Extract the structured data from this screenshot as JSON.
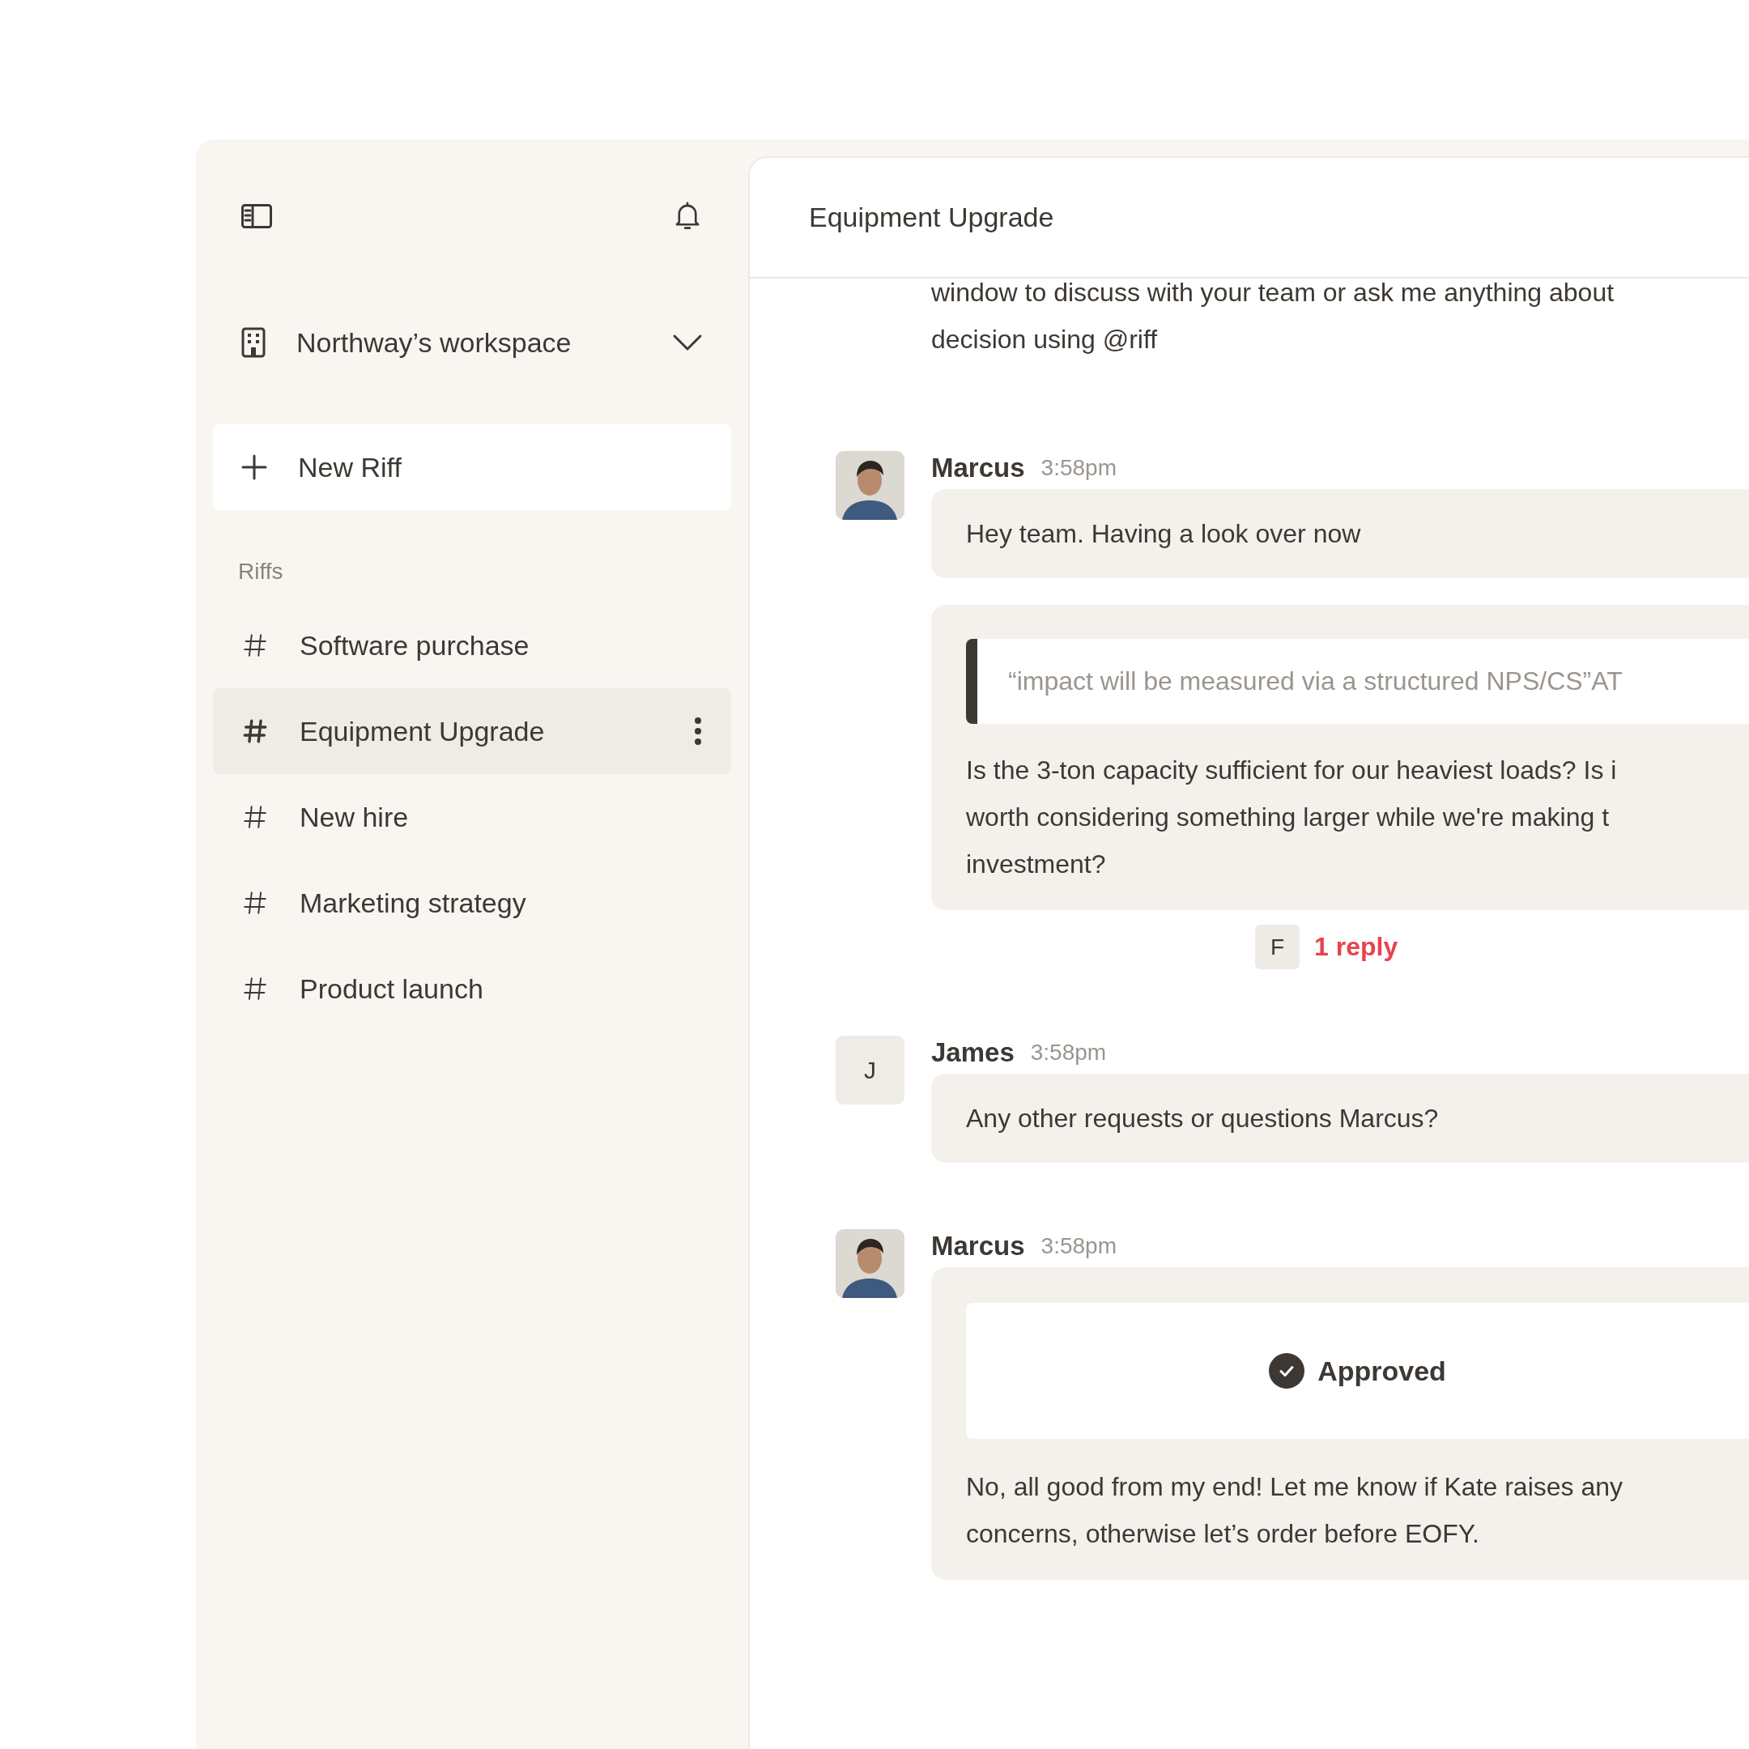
{
  "sidebar": {
    "workspace": "Northway’s workspace",
    "new_button": "New Riff",
    "section_label": "Riffs",
    "items": [
      {
        "label": "Software purchase",
        "selected": false
      },
      {
        "label": "Equipment Upgrade",
        "selected": true
      },
      {
        "label": "New hire",
        "selected": false
      },
      {
        "label": "Marketing strategy",
        "selected": false
      },
      {
        "label": "Product launch",
        "selected": false
      }
    ]
  },
  "channel": {
    "title": "Equipment Upgrade"
  },
  "intro_lines": [
    "window to discuss with your team or ask me anything about",
    "decision using @riff"
  ],
  "messages": [
    {
      "author": "Marcus",
      "time": "3:58pm",
      "avatar": {
        "kind": "picture"
      },
      "blocks": [
        {
          "kind": "text",
          "lines": [
            "Hey team. Having a look over now"
          ]
        },
        {
          "kind": "quote",
          "quote": "“impact will be measured via a structured NPS/CS”AT",
          "lines": [
            "Is the 3-ton capacity sufficient for our heaviest loads? Is i",
            "worth considering something larger while we're making t",
            "investment?"
          ],
          "thread": {
            "initial": "F",
            "replies": "1 reply"
          }
        }
      ]
    },
    {
      "author": "James",
      "time": "3:58pm",
      "avatar": {
        "kind": "initial",
        "initial": "J"
      },
      "blocks": [
        {
          "kind": "text",
          "lines": [
            "Any other requests or questions Marcus?"
          ]
        }
      ]
    },
    {
      "author": "Marcus",
      "time": "3:58pm",
      "avatar": {
        "kind": "picture"
      },
      "blocks": [
        {
          "kind": "status",
          "status": "Approved",
          "lines": [
            "No, all good from my end! Let me know if Kate raises any",
            "concerns, otherwise let’s order before EOFY."
          ]
        }
      ]
    }
  ]
}
